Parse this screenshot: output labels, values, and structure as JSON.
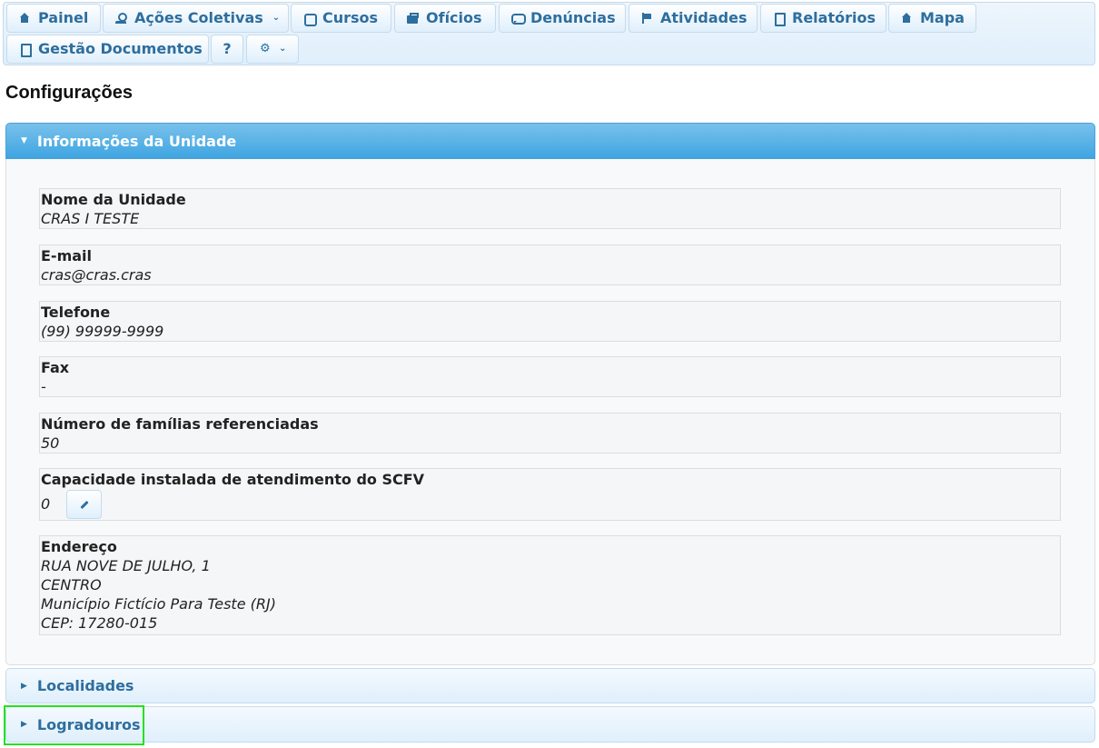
{
  "nav": {
    "row1": [
      {
        "label": "Painel",
        "icon": "home-icon"
      },
      {
        "label": "Ações Coletivas",
        "icon": "user-icon",
        "dropdown": true
      },
      {
        "label": "Cursos",
        "icon": "cursos-icon"
      },
      {
        "label": "Ofícios",
        "icon": "oficio-icon"
      },
      {
        "label": "Denúncias",
        "icon": "chat-icon"
      },
      {
        "label": "Atividades",
        "icon": "flag-icon"
      },
      {
        "label": "Relatórios",
        "icon": "document-icon"
      },
      {
        "label": "Mapa",
        "icon": "home-icon"
      }
    ],
    "row2": [
      {
        "label": "Gestão Documentos",
        "icon": "document-icon"
      },
      {
        "label": "?",
        "icon": "help"
      },
      {
        "label": "",
        "icon": "gear-icon",
        "dropdown": true
      }
    ]
  },
  "page": {
    "title": "Configurações"
  },
  "accordion": {
    "info": {
      "title": "Informações da Unidade",
      "fields": {
        "nome": {
          "label": "Nome da Unidade",
          "value": "CRAS I TESTE"
        },
        "email": {
          "label": "E-mail",
          "value": "cras@cras.cras"
        },
        "telefone": {
          "label": "Telefone",
          "value": "(99) 99999-9999"
        },
        "fax": {
          "label": "Fax",
          "value": "-"
        },
        "familias": {
          "label": "Número de famílias referenciadas",
          "value": "50"
        },
        "capacidade": {
          "label": "Capacidade instalada de atendimento do SCFV",
          "value": "0"
        },
        "endereco": {
          "label": "Endereço",
          "lines": [
            "RUA NOVE DE JULHO, 1",
            "CENTRO",
            "Município Fictício Para Teste (RJ)",
            "CEP: 17280-015"
          ]
        }
      }
    },
    "localidades": {
      "title": "Localidades"
    },
    "logradouros": {
      "title": "Logradouros"
    }
  },
  "colors": {
    "accent": "#2e6e9e",
    "active_header": "#3fa5e1",
    "highlight": "#22e21f"
  }
}
